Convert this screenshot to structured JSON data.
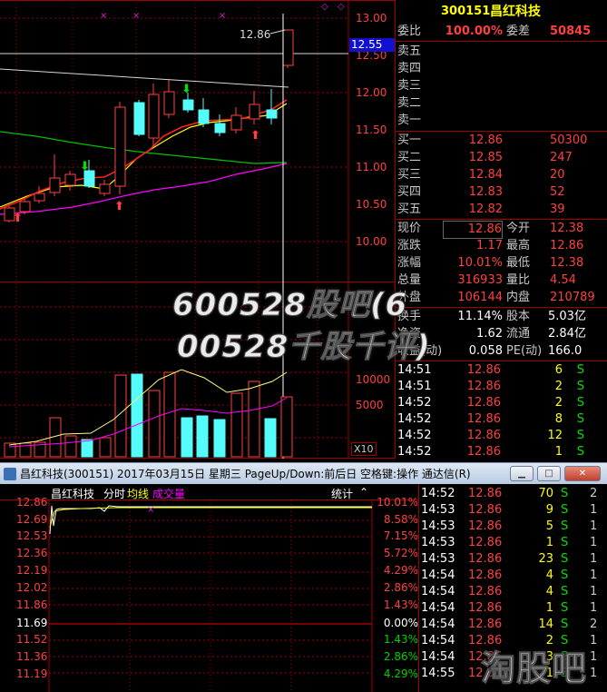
{
  "kline": {
    "price_ticks": [
      "13.00",
      "12.50",
      "12.00",
      "11.50",
      "11.00",
      "10.50",
      "10.00"
    ],
    "current_price_tag": "12.55",
    "high_marker": "12.86",
    "volume_ticks": [
      "10000",
      "5000"
    ],
    "volume_unit": "X10"
  },
  "quote": {
    "code": "300151",
    "name": "昌红科技",
    "weibi_label": "委比",
    "weibi_value": "100.00%",
    "weicha_label": "委差",
    "weicha_value": "50845",
    "sell": [
      {
        "label": "卖五"
      },
      {
        "label": "卖四"
      },
      {
        "label": "卖三"
      },
      {
        "label": "卖二"
      },
      {
        "label": "卖一"
      }
    ],
    "buy": [
      {
        "label": "买一",
        "price": "12.86",
        "vol": "50300"
      },
      {
        "label": "买二",
        "price": "12.85",
        "vol": "247"
      },
      {
        "label": "买三",
        "price": "12.84",
        "vol": "20"
      },
      {
        "label": "买四",
        "price": "12.83",
        "vol": "52"
      },
      {
        "label": "买五",
        "price": "12.82",
        "vol": "39"
      }
    ],
    "stats": [
      {
        "l1": "现价",
        "v1": "12.86",
        "l2": "今开",
        "v2": "12.38"
      },
      {
        "l1": "涨跌",
        "v1": "1.17",
        "l2": "最高",
        "v2": "12.86"
      },
      {
        "l1": "涨幅",
        "v1": "10.01%",
        "l2": "最低",
        "v2": "12.38"
      },
      {
        "l1": "总量",
        "v1": "316933",
        "l2": "量比",
        "v2": "4.54"
      },
      {
        "l1": "外盘",
        "v1": "106144",
        "l2": "内盘",
        "v2": "210789"
      }
    ],
    "stats2": [
      {
        "l1": "换手",
        "v1": "11.14%",
        "l2": "股本",
        "v2": "5.03亿"
      },
      {
        "l1": "净资",
        "v1": "1.62",
        "l2": "流通",
        "v2": "2.84亿"
      },
      {
        "l1": "收益(动)",
        "v1": "0.058",
        "l2": "PE(动)",
        "v2": "166.0"
      }
    ],
    "ticks": [
      {
        "time": "14:51",
        "price": "12.86",
        "vol": "6",
        "bs": "S"
      },
      {
        "time": "14:51",
        "price": "12.86",
        "vol": "2",
        "bs": "S"
      },
      {
        "time": "14:52",
        "price": "12.86",
        "vol": "2",
        "bs": "S"
      },
      {
        "time": "14:52",
        "price": "12.86",
        "vol": "8",
        "bs": "S"
      },
      {
        "time": "14:52",
        "price": "12.86",
        "vol": "12",
        "bs": "S"
      },
      {
        "time": "14:52",
        "price": "12.86",
        "vol": "1",
        "bs": "S"
      }
    ]
  },
  "window": {
    "title": "昌红科技(300151) 2017年03月15日 星期三 PageUp/Down:前后日 空格键:操作 通达信(R)",
    "min": "▁",
    "max": "□",
    "close": "✕"
  },
  "intraday": {
    "header_name": "昌红科技",
    "header_tabs": [
      "分时",
      "均线",
      "成交量"
    ],
    "header_right": "统计",
    "left_ticks": [
      "12.86",
      "12.69",
      "12.53",
      "12.36",
      "12.19",
      "12.02",
      "11.86",
      "11.69",
      "11.52",
      "11.36",
      "11.19"
    ],
    "right_ticks": [
      "10.01%",
      "8.58%",
      "7.15%",
      "5.72%",
      "4.29%",
      "2.86%",
      "1.43%",
      "0.00%",
      "1.43%",
      "2.86%",
      "4.29%"
    ]
  },
  "ticks2": [
    {
      "time": "14:52",
      "price": "12.86",
      "vol": "70",
      "bs": "S",
      "n": "2"
    },
    {
      "time": "14:53",
      "price": "12.86",
      "vol": "9",
      "bs": "S",
      "n": "1"
    },
    {
      "time": "14:53",
      "price": "12.86",
      "vol": "5",
      "bs": "S",
      "n": "1"
    },
    {
      "time": "14:53",
      "price": "12.86",
      "vol": "1",
      "bs": "S",
      "n": "1"
    },
    {
      "time": "14:53",
      "price": "12.86",
      "vol": "23",
      "bs": "S",
      "n": "1"
    },
    {
      "time": "14:54",
      "price": "12.86",
      "vol": "4",
      "bs": "S",
      "n": "1"
    },
    {
      "time": "14:54",
      "price": "12.86",
      "vol": "4",
      "bs": "S",
      "n": "1"
    },
    {
      "time": "14:54",
      "price": "12.86",
      "vol": "1",
      "bs": "S",
      "n": "1"
    },
    {
      "time": "14:54",
      "price": "12.86",
      "vol": "14",
      "bs": "S",
      "n": "2"
    },
    {
      "time": "14:54",
      "price": "12.86",
      "vol": "2",
      "bs": "S",
      "n": "1"
    },
    {
      "time": "14:54",
      "price": "12.86",
      "vol": "3",
      "bs": "S",
      "n": "1"
    },
    {
      "time": "14:55",
      "price": "12.86",
      "vol": "1",
      "bs": "S",
      "n": "1"
    }
  ],
  "watermark": {
    "line1": "600528股吧(6",
    "line2": "00528千股千评)",
    "logo": "淘股吧"
  },
  "colors": {
    "up": "#ff4040",
    "down_candle": "#54fcfc",
    "ma5": "#ffffff",
    "ma10": "#ffff00",
    "ma20": "#ff00ff",
    "ma60": "#00c000"
  }
}
